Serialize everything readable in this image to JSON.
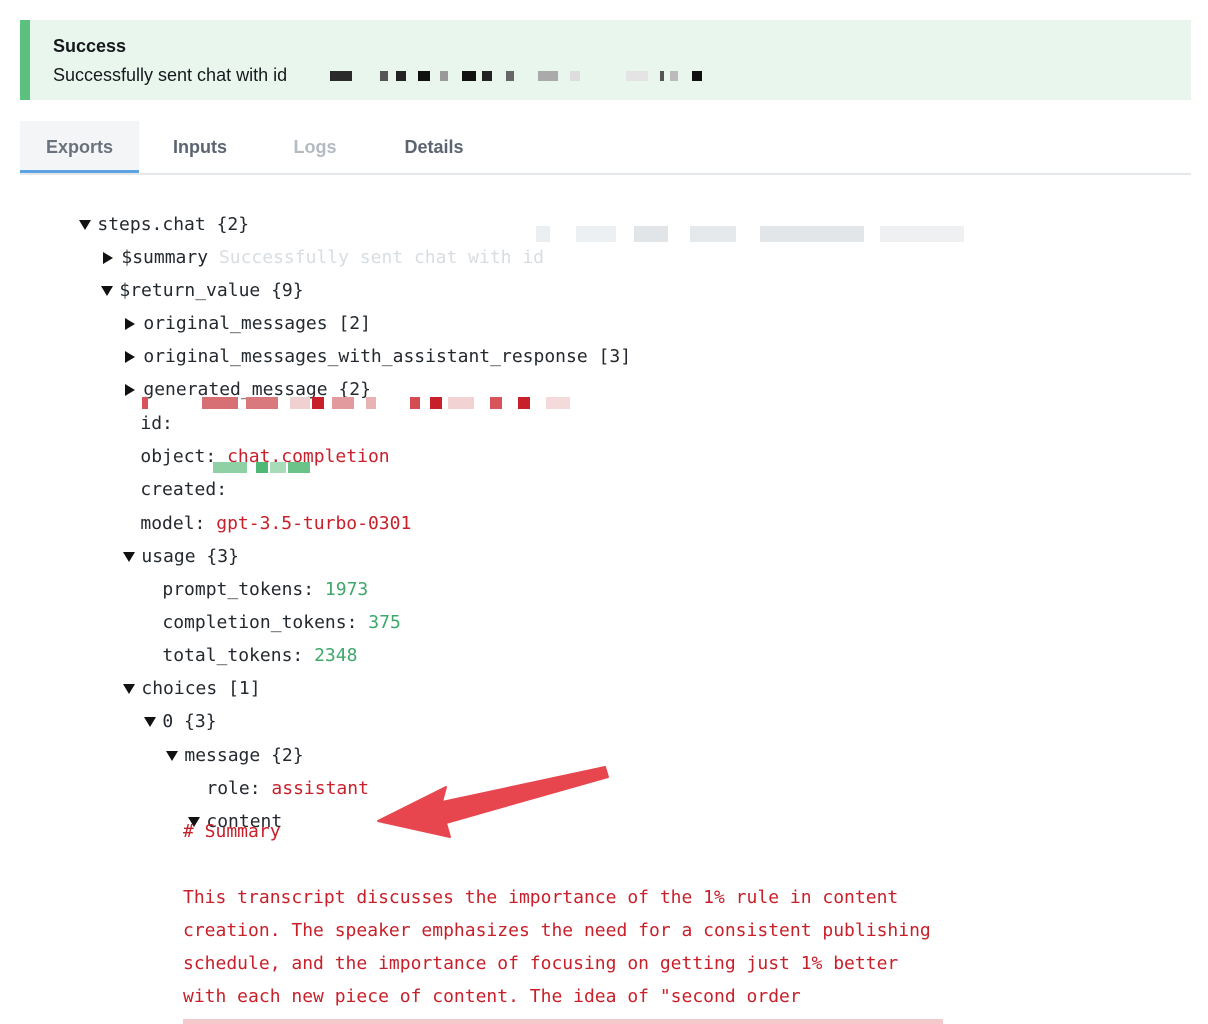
{
  "banner": {
    "title": "Success",
    "message": "Successfully sent chat with id"
  },
  "tabs": [
    {
      "label": "Exports",
      "state": "active"
    },
    {
      "label": "Inputs",
      "state": "normal"
    },
    {
      "label": "Logs",
      "state": "disabled"
    },
    {
      "label": "Details",
      "state": "normal"
    }
  ],
  "tree": {
    "steps_chat": {
      "key": "steps.chat",
      "meta": "{2}"
    },
    "summary": {
      "key": "$summary",
      "value": "Successfully sent chat with id"
    },
    "return_value": {
      "key": "$return_value",
      "meta": "{9}"
    },
    "original_messages": {
      "key": "original_messages",
      "meta": "[2]"
    },
    "original_messages_with_assistant_response": {
      "key": "original_messages_with_assistant_response",
      "meta": "[3]"
    },
    "generated_message": {
      "key": "generated_message",
      "meta": "{2}"
    },
    "id": {
      "key": "id:"
    },
    "object": {
      "key": "object:",
      "value": "chat.completion"
    },
    "created": {
      "key": "created:"
    },
    "model": {
      "key": "model:",
      "value": "gpt-3.5-turbo-0301"
    },
    "usage": {
      "key": "usage",
      "meta": "{3}"
    },
    "prompt_tokens": {
      "key": "prompt_tokens:",
      "value": "1973"
    },
    "completion_tokens": {
      "key": "completion_tokens:",
      "value": "375"
    },
    "total_tokens": {
      "key": "total_tokens:",
      "value": "2348"
    },
    "choices": {
      "key": "choices",
      "meta": "[1]"
    },
    "choice_0": {
      "key": "0",
      "meta": "{3}"
    },
    "message": {
      "key": "message",
      "meta": "{2}"
    },
    "role": {
      "key": "role:",
      "value": "assistant"
    },
    "content": {
      "key": "content"
    },
    "content_lines": [
      "# Summary",
      "",
      "This transcript discusses the importance of the 1% rule in content",
      "creation. The speaker emphasizes the need for a consistent publishing",
      "schedule, and the importance of focusing on getting just 1% better",
      "with each new piece of content. The idea of \"second order"
    ]
  },
  "colors": {
    "success_accent": "#5cc07f",
    "success_bg": "#e9f6ee",
    "string_value": "#c8202a",
    "number_value": "#3ea86a",
    "tab_active_underline": "#5da3e3",
    "annotation_arrow": "#e8464e"
  }
}
